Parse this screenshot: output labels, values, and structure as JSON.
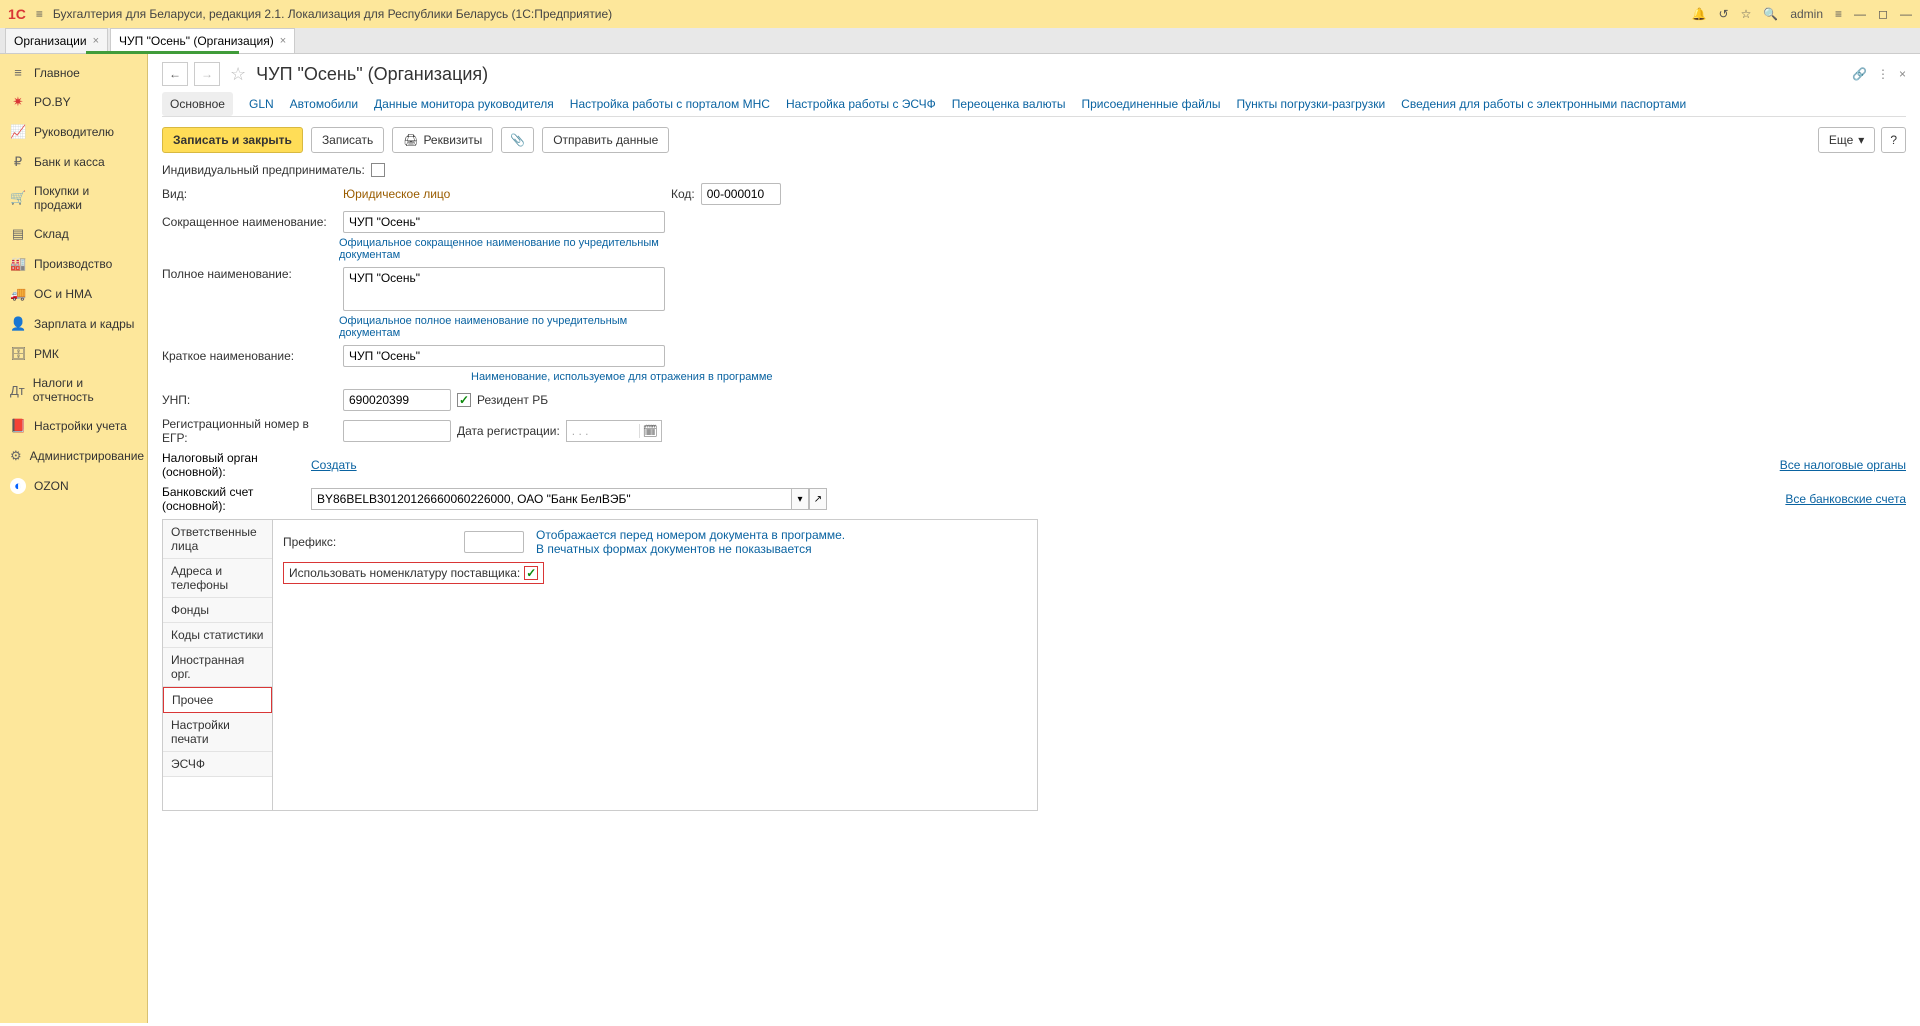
{
  "titlebar": {
    "app_title": "Бухгалтерия для Беларуси, редакция 2.1. Локализация для Республики Беларусь   (1С:Предприятие)",
    "user": "admin"
  },
  "tabs": [
    {
      "label": "Организации"
    },
    {
      "label": "ЧУП \"Осень\" (Организация)"
    }
  ],
  "sidebar": [
    {
      "icon": "≡",
      "label": "Главное"
    },
    {
      "icon": "✷",
      "label": "PO.BY",
      "cls": "poby"
    },
    {
      "icon": "📈",
      "label": "Руководителю"
    },
    {
      "icon": "₽",
      "label": "Банк и касса"
    },
    {
      "icon": "🛒",
      "label": "Покупки и продажи"
    },
    {
      "icon": "▤",
      "label": "Склад"
    },
    {
      "icon": "🏭",
      "label": "Производство"
    },
    {
      "icon": "🚚",
      "label": "ОС и НМА"
    },
    {
      "icon": "👤",
      "label": "Зарплата и кадры"
    },
    {
      "icon": "🗄",
      "label": "РМК"
    },
    {
      "icon": "Дт",
      "label": "Налоги и отчетность"
    },
    {
      "icon": "📕",
      "label": "Настройки учета"
    },
    {
      "icon": "⚙",
      "label": "Администрирование"
    },
    {
      "icon": "◐",
      "label": "OZON",
      "cls": "ozon"
    }
  ],
  "page": {
    "title": "ЧУП \"Осень\" (Организация)"
  },
  "subnav": [
    "Основное",
    "GLN",
    "Автомобили",
    "Данные монитора руководителя",
    "Настройка работы с порталом МНС",
    "Настройка работы с ЭСЧФ",
    "Переоценка валюты",
    "Присоединенные файлы",
    "Пункты погрузки-разгрузки",
    "Сведения для работы с электронными паспортами"
  ],
  "toolbar": {
    "save_close": "Записать и закрыть",
    "save": "Записать",
    "details": "Реквизиты",
    "send": "Отправить данные",
    "more": "Еще"
  },
  "form": {
    "ip_label": "Индивидуальный предприниматель:",
    "view_label": "Вид:",
    "view_value": "Юридическое лицо",
    "code_label": "Код:",
    "code_value": "00-000010",
    "short_name_label": "Сокращенное наименование:",
    "short_name_value": "ЧУП \"Осень\"",
    "short_name_hint": "Официальное сокращенное наименование по учредительным документам",
    "full_name_label": "Полное наименование:",
    "full_name_value": "ЧУП \"Осень\"",
    "full_name_hint": "Официальное полное наименование по учредительным документам",
    "brief_name_label": "Краткое наименование:",
    "brief_name_value": "ЧУП \"Осень\"",
    "brief_name_hint": "Наименование, используемое для отражения в программе",
    "unp_label": "УНП:",
    "unp_value": "690020399",
    "resident_label": "Резидент РБ",
    "egr_label": "Регистрационный номер в ЕГР:",
    "egr_value": "",
    "reg_date_label": "Дата регистрации:",
    "reg_date_value": ". . .",
    "tax_label": "Налоговый орган (основной):",
    "tax_create": "Создать",
    "tax_all": "Все налоговые органы",
    "bank_label": "Банковский счет (основной):",
    "bank_value": "BY86BELB30120126660060226000, ОАО \"Банк БелВЭБ\"",
    "bank_all": "Все банковские счета"
  },
  "tabpanel": {
    "tabs": [
      "Ответственные лица",
      "Адреса и телефоны",
      "Фонды",
      "Коды статистики",
      "Иностранная орг.",
      "Прочее",
      "Настройки печати",
      "ЭСЧФ"
    ],
    "prefix_label": "Префикс:",
    "prefix_value": "",
    "prefix_hint1": "Отображается перед номером документа в программе.",
    "prefix_hint2": "В печатных формах документов не показывается",
    "use_supplier_label": "Использовать номенклатуру поставщика:"
  }
}
